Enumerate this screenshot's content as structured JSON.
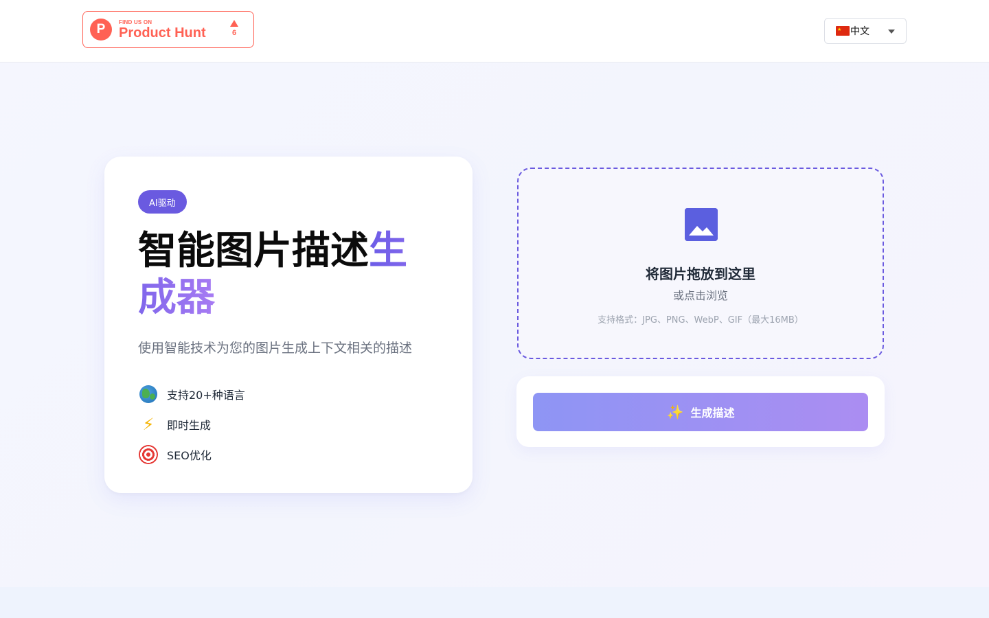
{
  "header": {
    "product_hunt": {
      "small_text": "FIND US ON",
      "big_text": "Product Hunt",
      "logo_letter": "P",
      "vote_count": "6",
      "color": "#ff6154"
    },
    "language": {
      "selected": "中文",
      "flag": "cn-flag-icon"
    }
  },
  "hero": {
    "badge": "AI驱动",
    "title_main": "智能图片描述生成器",
    "title_accent": "生成器",
    "subtitle": "使用智能技术为您的图片生成上下文相关的描述",
    "accent_color": "#6a5ae0",
    "features": [
      {
        "icon": "globe-icon",
        "label": "支持20+种语言"
      },
      {
        "icon": "lightning-icon",
        "label": "即时生成"
      },
      {
        "icon": "target-icon",
        "label": "SEO优化"
      }
    ]
  },
  "upload": {
    "title": "将图片拖放到这里",
    "browse": "或点击浏览",
    "formats": "支持格式：JPG、PNG、WebP、GIF（最大16MB）",
    "icon": "image-icon"
  },
  "action": {
    "generate_label": "生成描述",
    "icon": "sparkle-icon"
  }
}
